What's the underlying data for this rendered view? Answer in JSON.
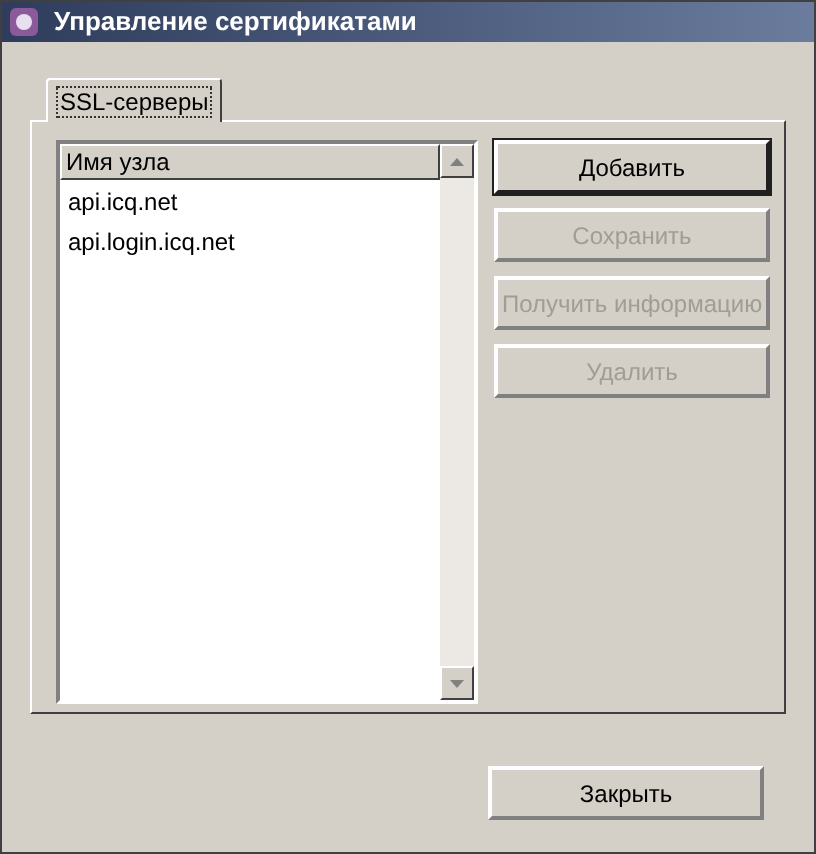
{
  "window": {
    "title": "Управление сертификатами"
  },
  "tabs": [
    {
      "label": "SSL-серверы",
      "selected": true
    }
  ],
  "list": {
    "columns": [
      "Имя узла"
    ],
    "rows": [
      "api.icq.net",
      "api.login.icq.net"
    ]
  },
  "buttons": [
    {
      "label": "Добавить",
      "disabled": false
    },
    {
      "label": "Сохранить",
      "disabled": true
    },
    {
      "label": "Получить информацию",
      "disabled": true
    },
    {
      "label": "Удалить",
      "disabled": true
    }
  ],
  "close_button": {
    "label": "Закрыть",
    "disabled": false
  }
}
